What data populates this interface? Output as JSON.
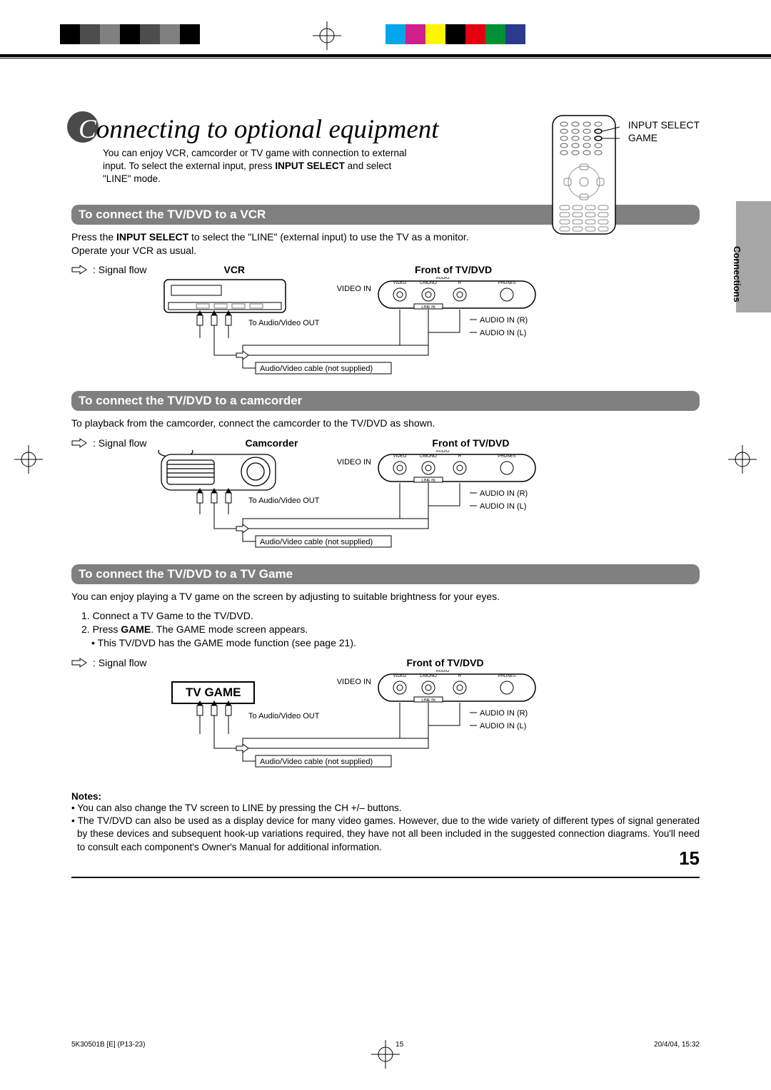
{
  "title": "Connecting to optional equipment",
  "intro_plain_1": "You can enjoy VCR, camcorder or TV game with connection to external input. To select the external input, press ",
  "intro_bold": "INPUT SELECT",
  "intro_plain_2": " and select \"LINE\" mode.",
  "remote": {
    "label1": "INPUT SELECT",
    "label2": "GAME"
  },
  "side_tab": "Connections",
  "sections": {
    "vcr": {
      "heading": "To connect the TV/DVD to a VCR",
      "line1a": "Press the ",
      "line1bold": "INPUT SELECT",
      "line1b": " to select the \"LINE\" (external input) to use the TV as a monitor.",
      "line2": "Operate your VCR as usual.",
      "signal_label": ": Signal flow",
      "device_label": "VCR",
      "panel_label": "Front of TV/DVD",
      "video_in": "VIDEO IN",
      "audio_r": "AUDIO IN (R)",
      "audio_l": "AUDIO IN (L)",
      "to_out": "To Audio/Video OUT",
      "cable_note": "Audio/Video cable (not supplied)",
      "jacks": {
        "video": "VIDEO",
        "lmono": "L/MONO",
        "audio_top": "AUDIO",
        "r": "R",
        "phones": "PHONES",
        "linein": "LINE IN"
      }
    },
    "cam": {
      "heading": "To connect the TV/DVD to a camcorder",
      "intro": "To playback from the camcorder, connect the camcorder to the TV/DVD as shown.",
      "signal_label": ": Signal flow",
      "device_label": "Camcorder",
      "panel_label": "Front of TV/DVD",
      "video_in": "VIDEO IN",
      "audio_r": "AUDIO IN (R)",
      "audio_l": "AUDIO IN (L)",
      "to_out": "To Audio/Video OUT",
      "cable_note": "Audio/Video cable (not supplied)",
      "jacks": {
        "video": "VIDEO",
        "lmono": "L/MONO",
        "audio_top": "AUDIO",
        "r": "R",
        "phones": "PHONES",
        "linein": "LINE IN"
      }
    },
    "game": {
      "heading": "To connect the TV/DVD to a TV Game",
      "intro": "You can enjoy playing a TV game on the screen by adjusting to suitable brightness for your eyes.",
      "step1": "1. Connect a TV Game to the TV/DVD.",
      "step2a": "2. Press ",
      "step2bold": "GAME",
      "step2b": ". The GAME mode screen appears.",
      "bullet": "• This TV/DVD has the GAME mode function (see page 21).",
      "signal_label": ": Signal flow",
      "device_label": "TV GAME",
      "panel_label": "Front of TV/DVD",
      "video_in": "VIDEO IN",
      "audio_r": "AUDIO IN (R)",
      "audio_l": "AUDIO IN (L)",
      "to_out": "To Audio/Video OUT",
      "cable_note": "Audio/Video cable (not supplied)",
      "jacks": {
        "video": "VIDEO",
        "lmono": "L/MONO",
        "audio_top": "AUDIO",
        "r": "R",
        "phones": "PHONES",
        "linein": "LINE IN"
      }
    }
  },
  "notes": {
    "heading": "Notes:",
    "items": [
      "You can also change the TV screen to LINE by pressing the CH +/– buttons.",
      "The TV/DVD can also be used as a display device for many video games. However, due to the wide variety of different types of signal generated by these devices and subsequent hook-up variations required, they have not all been included in the suggested connection diagrams. You'll need to consult each component's Owner's Manual for additional information."
    ]
  },
  "page_number": "15",
  "footer": {
    "left": "5K30501B [E] (P13-23)",
    "mid": "15",
    "right": "20/4/04, 15:32"
  },
  "colors": {
    "bar_left": [
      "#000000",
      "#4d4d4d",
      "#808080",
      "#000000",
      "#4d4d4d",
      "#808080",
      "#000000"
    ],
    "bar_right": [
      "#00a6eb",
      "#d11f8e",
      "#fff500",
      "#000000",
      "#e3000f",
      "#009036",
      "#2a3b8e"
    ]
  }
}
